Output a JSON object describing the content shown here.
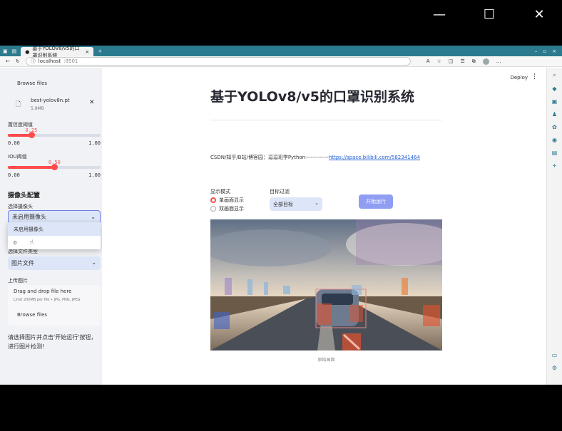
{
  "window_controls": {
    "minimize": "—",
    "maximize": "☐",
    "close": "✕"
  },
  "browser": {
    "tab_title": "基于YOLOv8/v5的口罩识别系统",
    "tab_close": "×",
    "new_tab": "+",
    "url_protocol_icon": "info-icon",
    "url": "localhost",
    "url_port": ":8501"
  },
  "toolbar": {
    "deploy_label": "Deploy",
    "menu": "⋮"
  },
  "sidebar": {
    "browse_top": "Browse files",
    "model_file": {
      "name": "best-yolov8n.pt",
      "size": "5.9MB"
    },
    "conf": {
      "label": "置信度阈值",
      "value": "0.25",
      "min": "0.00",
      "max": "1.00",
      "fraction": 0.25
    },
    "iou": {
      "label": "IOU阈值",
      "value": "0.50",
      "min": "0.00",
      "max": "1.00",
      "fraction": 0.5
    },
    "camera_section": "摄像头配置",
    "camera_label": "选择摄像头",
    "camera_value": "未启用摄像头",
    "camera_options": [
      "未启用摄像头",
      "0"
    ],
    "file_type_label": "选择文件类型",
    "file_type_value": "图片文件",
    "upload_label": "上传图片",
    "upload_title": "Drag and drop file here",
    "upload_sub": "Limit 200MB per file • JPG, PNG, JPEG",
    "browse_bottom": "Browse files",
    "hint": "请选择图片并点击'开始运行'按钮，进行图片检测!"
  },
  "main": {
    "title": "基于YOLOv8/v5的口罩识别系统",
    "credit_text": "CSDN/知乎/B站/博客园：逗逗班学Python-------------",
    "credit_link": "https://space.bilibili.com/582341464",
    "mode_label": "显示模式",
    "modes": [
      "单画面显示",
      "双画面显示"
    ],
    "target_label": "目标过滤",
    "target_value": "全部目标",
    "run_button": "开始运行",
    "image_caption": "原始画面"
  },
  "colors": {
    "accent": "#ff4b4b",
    "select_bg": "#dde6f8",
    "run_button": "#8f9ef2",
    "tabbar": "#2c7a8d"
  }
}
